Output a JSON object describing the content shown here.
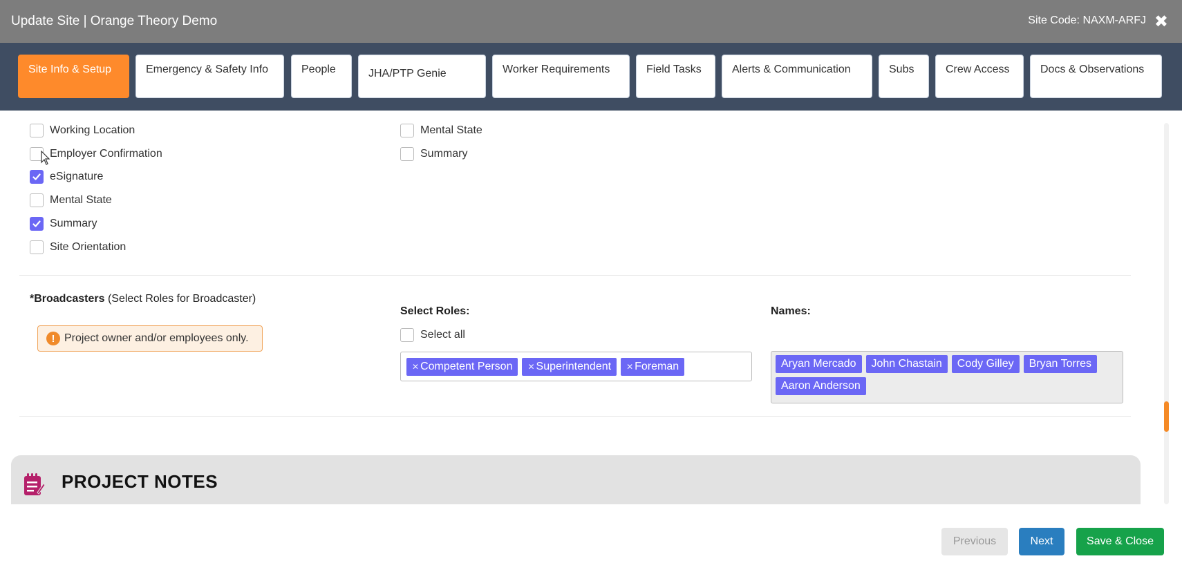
{
  "header": {
    "title": "Update Site | Orange Theory Demo",
    "site_code": "Site Code: NAXM-ARFJ",
    "close_glyph": "✖"
  },
  "tabs": [
    {
      "label": "Site Info & Setup",
      "active": true
    },
    {
      "label": "Emergency & Safety Info"
    },
    {
      "label": "People"
    },
    {
      "label": "JHA/PTP Genie"
    },
    {
      "label": "Worker Requirements"
    },
    {
      "label": "Field Tasks"
    },
    {
      "label": "Alerts & Communication"
    },
    {
      "label": "Subs"
    },
    {
      "label": "Crew Access"
    },
    {
      "label": "Docs & Observations"
    }
  ],
  "checklist": {
    "left": [
      {
        "label": "Working Location",
        "checked": false
      },
      {
        "label": "Employer Confirmation",
        "checked": false
      },
      {
        "label": "eSignature",
        "checked": true
      },
      {
        "label": "Mental State",
        "checked": false
      },
      {
        "label": "Summary",
        "checked": true
      },
      {
        "label": "Site Orientation",
        "checked": false
      }
    ],
    "right": [
      {
        "label": "Mental State",
        "checked": false
      },
      {
        "label": "Summary",
        "checked": false
      }
    ]
  },
  "broadcasters": {
    "title_bold": "*Broadcasters",
    "title_rest": " (Select Roles for Broadcaster)",
    "warning": "Project owner and/or employees only.",
    "warning_icon": "!",
    "select_roles_label": "Select Roles:",
    "select_all_label": "Select all",
    "roles": [
      "Competent Person",
      "Superintendent",
      "Foreman"
    ],
    "names_label": "Names:",
    "names": [
      "Aryan Mercado",
      "John Chastain",
      "Cody Gilley",
      "Bryan Torres",
      "Aaron Anderson"
    ]
  },
  "notes": {
    "title": "PROJECT NOTES"
  },
  "footer": {
    "previous": "Previous",
    "next": "Next",
    "save_close": "Save & Close"
  },
  "colors": {
    "accent_orange": "#fe8a2b",
    "chip_purple": "#6b67f5",
    "next_blue": "#2a7ebf",
    "save_green": "#16a24a",
    "header_gray": "#7d7d7d",
    "tabbar_navy": "#3f4d62"
  }
}
